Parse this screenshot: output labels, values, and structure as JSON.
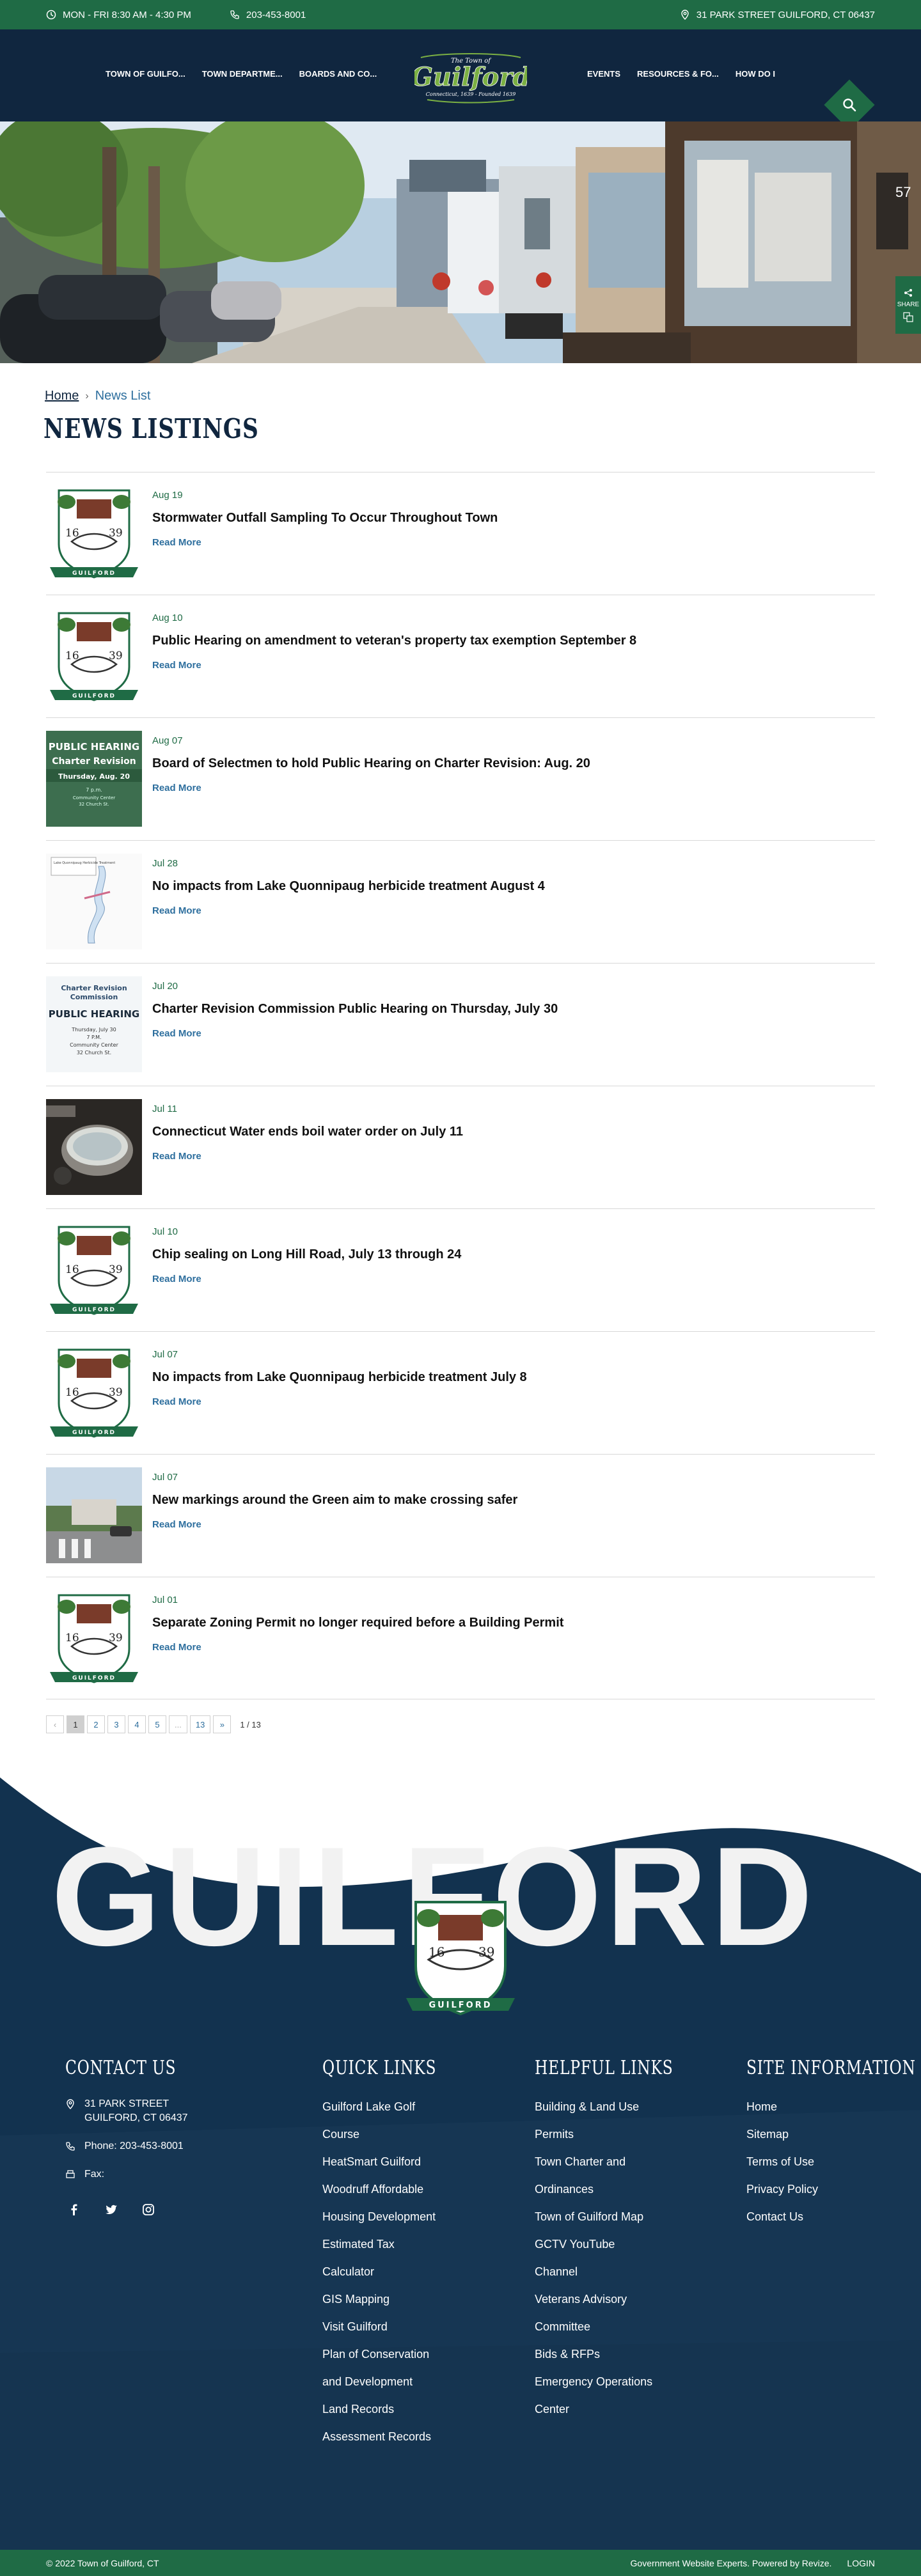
{
  "topbar": {
    "hours": "MON - FRI 8:30 AM - 4:30 PM",
    "phone": "203-453-8001",
    "address": "31 PARK STREET GUILFORD, CT 06437"
  },
  "nav": {
    "left": [
      "TOWN OF GUILFO...",
      "TOWN DEPARTME...",
      "BOARDS AND CO..."
    ],
    "right": [
      "EVENTS",
      "RESOURCES & FO...",
      "HOW DO I"
    ],
    "logo_text": "The Town of Guilford",
    "logo_sub": "Connecticut, 1639 - Founded 1639"
  },
  "hero": {
    "share_label": "SHARE",
    "storefront_number": "57"
  },
  "breadcrumb": {
    "home": "Home",
    "current": "News List"
  },
  "page_title": "NEWS LISTINGS",
  "news": [
    {
      "date": "Aug 19",
      "title": "Stormwater Outfall Sampling To Occur Throughout Town",
      "link": "Read More",
      "thumb": "seal"
    },
    {
      "date": "Aug 10",
      "title": "Public Hearing on amendment to veteran's property tax exemption September 8",
      "link": "Read More",
      "thumb": "seal"
    },
    {
      "date": "Aug 07",
      "title": "Board of Selectmen to hold Public Hearing on Charter Revision: Aug. 20",
      "link": "Read More",
      "thumb": "hearing"
    },
    {
      "date": "Jul 28",
      "title": "No impacts from Lake Quonnipaug herbicide treatment August 4",
      "link": "Read More",
      "thumb": "map"
    },
    {
      "date": "Jul 20",
      "title": "Charter Revision Commission Public Hearing on Thursday, July 30",
      "link": "Read More",
      "thumb": "charter"
    },
    {
      "date": "Jul 11",
      "title": "Connecticut Water ends boil water order on July 11",
      "link": "Read More",
      "thumb": "pot"
    },
    {
      "date": "Jul 10",
      "title": "Chip sealing on Long Hill Road, July 13 through 24",
      "link": "Read More",
      "thumb": "seal"
    },
    {
      "date": "Jul 07",
      "title": "No impacts from Lake Quonnipaug herbicide treatment July 8",
      "link": "Read More",
      "thumb": "seal"
    },
    {
      "date": "Jul 07",
      "title": "New markings around the Green aim to make crossing safer",
      "link": "Read More",
      "thumb": "street"
    },
    {
      "date": "Jul 01",
      "title": "Separate Zoning Permit no longer required before a Building Permit",
      "link": "Read More",
      "thumb": "seal"
    }
  ],
  "thumbs": {
    "hearing": {
      "line1": "PUBLIC HEARING",
      "line2": "Charter Revision",
      "line3": "Thursday, Aug. 20",
      "line4": "7 p.m.",
      "line5": "Community Center",
      "line6": "32 Church St."
    },
    "charter": {
      "line1": "Charter Revision",
      "line2": "Commission",
      "line3": "PUBLIC HEARING",
      "line4": "Thursday, July 30",
      "line5": "7 P.M.",
      "line6": "Community Center",
      "line7": "32 Church St."
    },
    "map": {
      "label": "Lake Quonnipaug Herbicide Treatment"
    },
    "seal": {
      "year_left": "16",
      "year_right": "39",
      "banner": "GUILFORD"
    }
  },
  "pagination": {
    "prev": "‹",
    "pages": [
      "1",
      "2",
      "3",
      "4",
      "5",
      "...",
      "13"
    ],
    "next": "»",
    "count": "1 / 13"
  },
  "footer": {
    "watermark": "GUILFORD",
    "logo_banner": "GUILFORD",
    "contact": {
      "title": "CONTACT US",
      "address_line1": "31 PARK STREET",
      "address_line2": "GUILFORD, CT 06437",
      "phone": "Phone: 203-453-8001",
      "fax": "Fax:"
    },
    "quick_links": {
      "title": "QUICK LINKS",
      "items": [
        "Guilford Lake Golf",
        "Course",
        "HeatSmart Guilford",
        "Woodruff Affordable",
        "Housing Development",
        "Estimated Tax",
        "Calculator",
        "GIS Mapping",
        "Visit Guilford",
        "Plan of Conservation",
        "and Development",
        "Land Records",
        "Assessment Records"
      ]
    },
    "helpful_links": {
      "title": "HELPFUL LINKS",
      "items": [
        "Building & Land Use",
        "Permits",
        "Town Charter and",
        "Ordinances",
        "Town of Guilford Map",
        "GCTV YouTube",
        "Channel",
        "Veterans Advisory",
        "Committee",
        "Bids & RFPs",
        "Emergency Operations",
        "Center"
      ]
    },
    "site_info": {
      "title": "SITE INFORMATION",
      "items": [
        "Home",
        "Sitemap",
        "Terms of Use",
        "Privacy Policy",
        "Contact Us"
      ]
    }
  },
  "bottombar": {
    "copyright": "© 2022 Town of Guilford, CT",
    "powered": "Government Website Experts. Powered by Revize.",
    "login": "LOGIN"
  },
  "colors": {
    "primary_green": "#1f6b45",
    "navy": "#10263f",
    "link_blue": "#2e6f9e"
  }
}
